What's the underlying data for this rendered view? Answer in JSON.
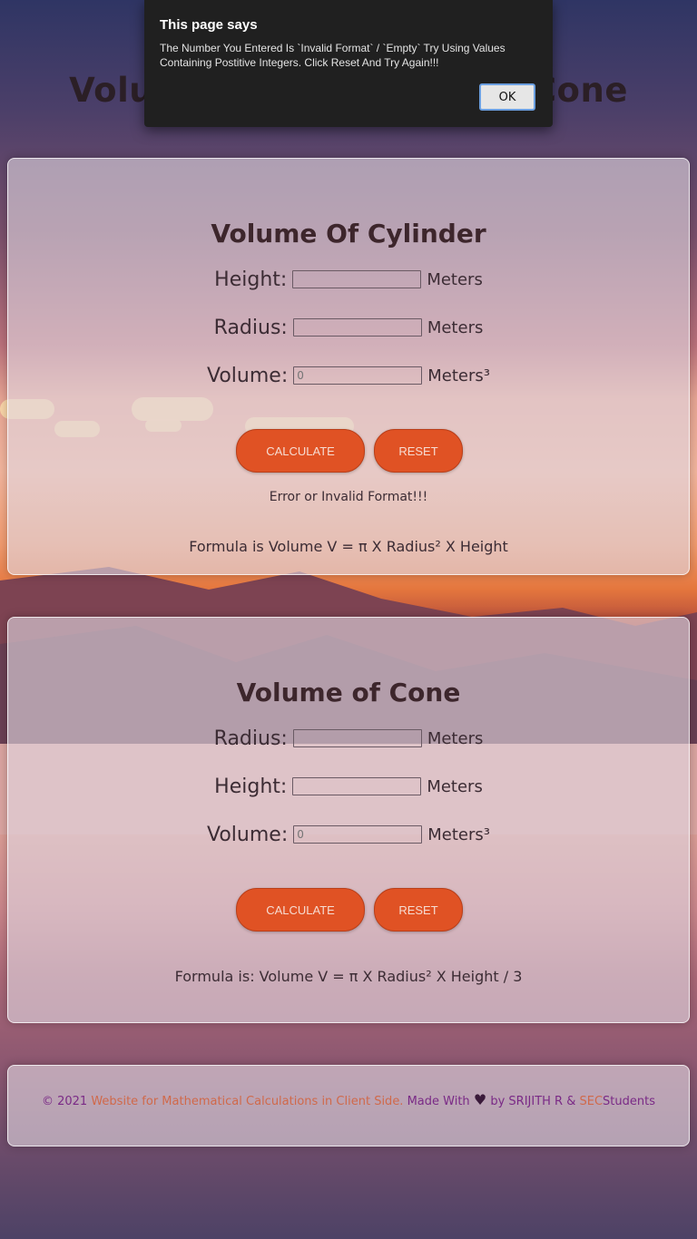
{
  "page": {
    "heading": "Volume of Cylinder and Cone"
  },
  "dialog": {
    "title": "This page says",
    "message": "The Number You Entered Is `Invalid Format` / `Empty` Try Using Values Containing Postitive Integers. Click Reset And Try Again!!!",
    "ok_label": "OK"
  },
  "cylinder": {
    "title": "Volume Of Cylinder",
    "height_label": "Height:",
    "height_value": "",
    "height_unit": "Meters",
    "radius_label": "Radius:",
    "radius_value": "",
    "radius_unit": "Meters",
    "volume_label": "Volume:",
    "volume_placeholder": "0",
    "volume_unit": "Meters³",
    "calculate_label": "CALCULATE",
    "reset_label": "RESET",
    "status": "Error or Invalid Format!!!",
    "formula": "Formula is Volume V = π X Radius² X Height"
  },
  "cone": {
    "title": "Volume of Cone",
    "radius_label": "Radius:",
    "radius_value": "",
    "radius_unit": "Meters",
    "height_label": "Height:",
    "height_value": "",
    "height_unit": "Meters",
    "volume_label": "Volume:",
    "volume_placeholder": "0",
    "volume_unit": "Meters³",
    "calculate_label": "CALCULATE",
    "reset_label": "RESET",
    "formula": "Formula is: Volume V = π X Radius² X Height / 3"
  },
  "footer": {
    "copyright": "© 2021",
    "site_text": "Website for Mathematical Calculations in Client Side.",
    "made_with": "Made With",
    "heart_icon": "heart-icon",
    "by": "by",
    "author": "SRIJITH R",
    "amp": "&",
    "org": "SEC",
    "students": "Students"
  },
  "colors": {
    "button": "#e05224",
    "dialog_bg": "#202020",
    "footer_purple": "#7a2a86",
    "footer_orange": "#d0694a"
  }
}
